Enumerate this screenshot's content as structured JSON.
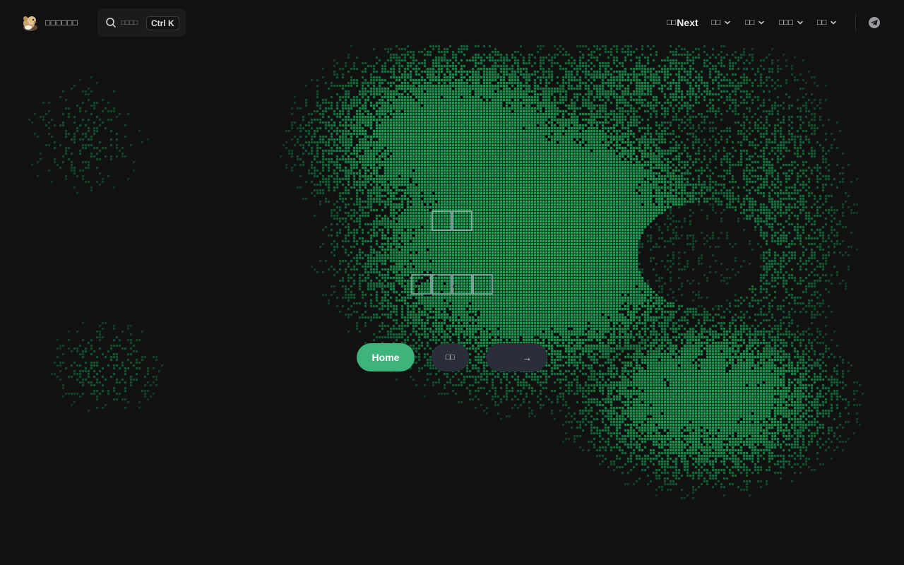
{
  "colors": {
    "background": "#111112",
    "accent": "#3fb37c",
    "pixel_green": "#27a158",
    "secondary_button": "#2a2e38",
    "title_gradient": [
      "#4fb58d",
      "#b9bcc6"
    ]
  },
  "header": {
    "brand": {
      "name": "□□□□□□",
      "logo_icon": "mascot-logo-icon"
    },
    "search": {
      "icon": "search-icon",
      "placeholder": "□□□□",
      "shortcut": "Ctrl K"
    },
    "nav": {
      "next": {
        "prefix": "□□",
        "label": "Next"
      },
      "menus": [
        {
          "label": "□□",
          "icon": "chevron-down-icon"
        },
        {
          "label": "□□",
          "icon": "chevron-down-icon"
        },
        {
          "label": "□□□",
          "icon": "chevron-down-icon"
        },
        {
          "label": "□□",
          "icon": "chevron-down-icon"
        }
      ],
      "social_icon": "telegram-icon"
    }
  },
  "hero": {
    "title_line1": "□□",
    "title_line2": "□□□□",
    "buttons": {
      "primary": "Home",
      "secondary": "□□",
      "tertiary": "→"
    },
    "background": "green-pixel-dither-pattern"
  }
}
